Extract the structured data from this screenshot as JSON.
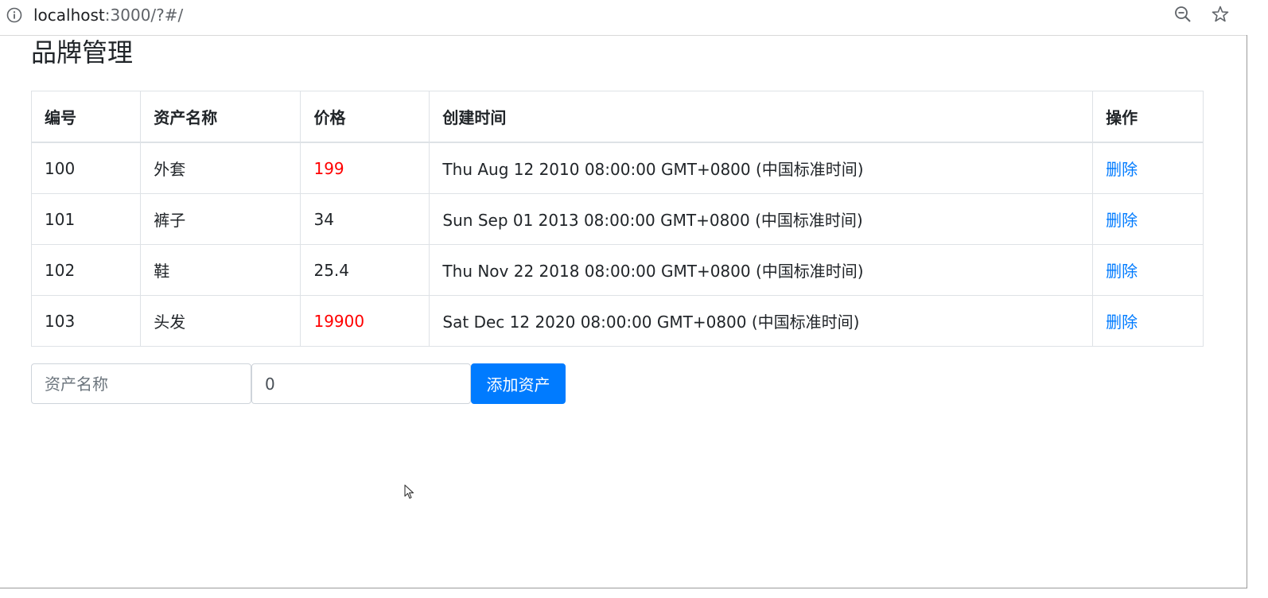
{
  "browser": {
    "url_host": "localhost",
    "url_rest": ":3000/?#/",
    "icons": [
      "info-icon",
      "zoom-out-icon",
      "star-icon"
    ]
  },
  "page": {
    "title": "品牌管理"
  },
  "table": {
    "headers": [
      "编号",
      "资产名称",
      "价格",
      "创建时间",
      "操作"
    ],
    "rows": [
      {
        "id": "100",
        "name": "外套",
        "price": "199",
        "created": "Thu Aug 12 2010 08:00:00 GMT+0800 (中国标准时间)",
        "action": "删除"
      },
      {
        "id": "101",
        "name": "裤子",
        "price": "34",
        "created": "Sun Sep 01 2013 08:00:00 GMT+0800 (中国标准时间)",
        "action": "删除"
      },
      {
        "id": "102",
        "name": "鞋",
        "price": "25.4",
        "created": "Thu Nov 22 2018 08:00:00 GMT+0800 (中国标准时间)",
        "action": "删除"
      },
      {
        "id": "103",
        "name": "头发",
        "price": "19900",
        "created": "Sat Dec 12 2020 08:00:00 GMT+0800 (中国标准时间)",
        "action": "删除"
      }
    ]
  },
  "form": {
    "name_placeholder": "资产名称",
    "name_value": "",
    "price_value": "0",
    "add_label": "添加资产"
  },
  "colors": {
    "accent": "#007bff",
    "price_high": "#ff0000",
    "border": "#dee2e6",
    "text": "#212529"
  }
}
